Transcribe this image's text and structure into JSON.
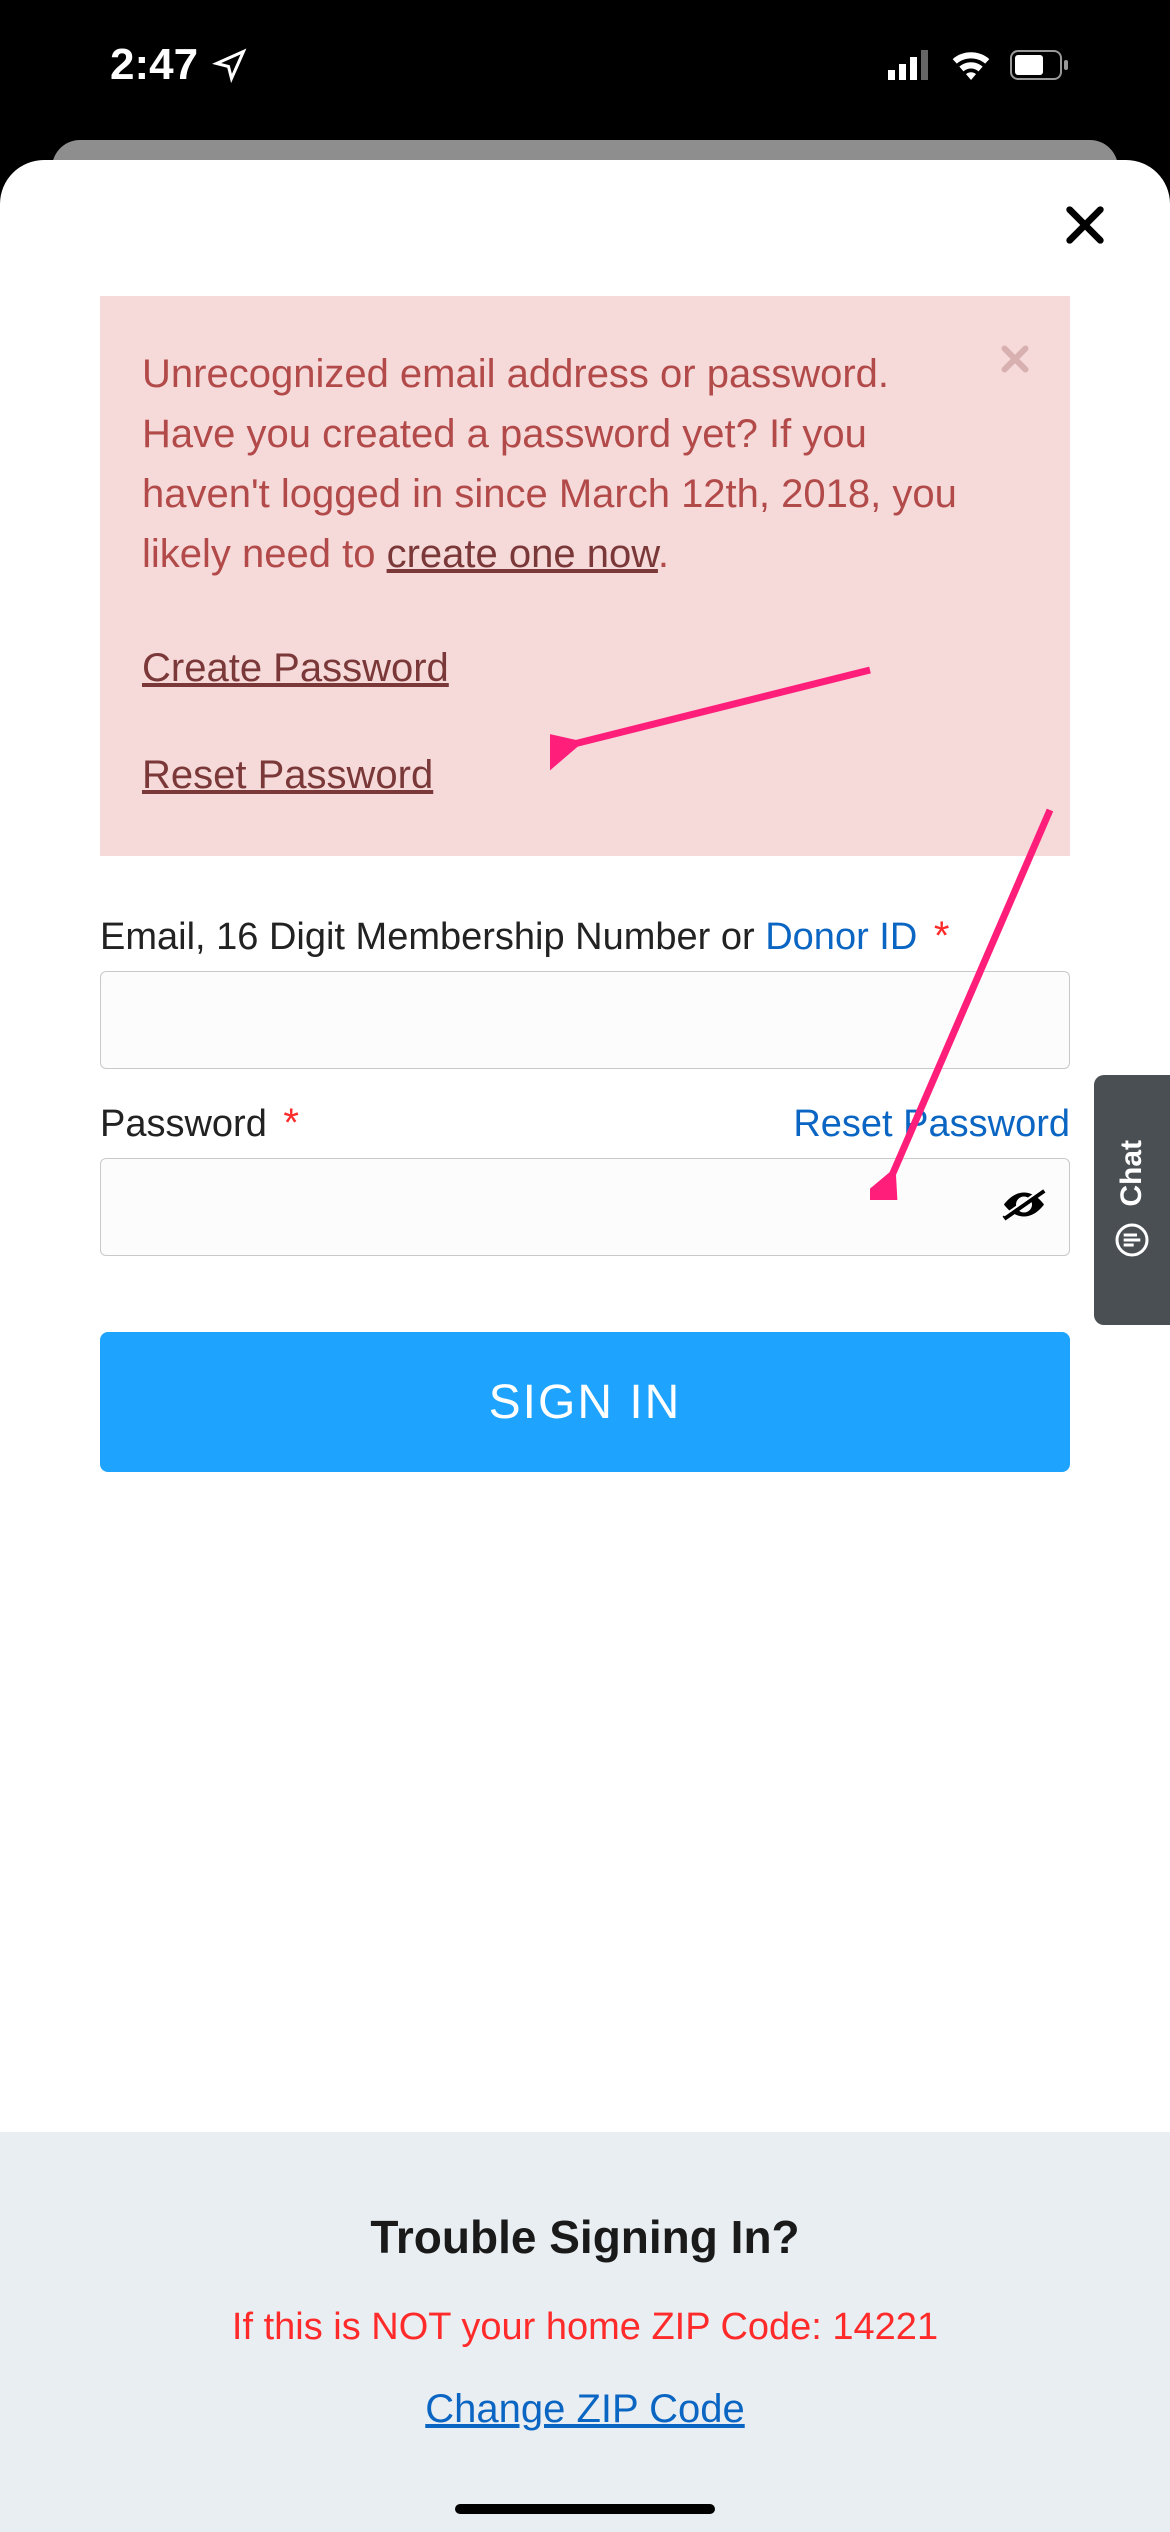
{
  "statusBar": {
    "time": "2:47"
  },
  "modal": {
    "alert": {
      "message_prefix": "Unrecognized email address or password. Have you created a password yet? If you haven't logged in since March 12th, 2018, you likely need to ",
      "message_link": "create one now",
      "message_suffix": ".",
      "create_password": "Create Password",
      "reset_password": "Reset Password"
    },
    "form": {
      "email_label_prefix": "Email, 16 Digit Membership Number or ",
      "email_label_link": "Donor ID",
      "password_label": "Password",
      "reset_password_link": "Reset Password",
      "required_mark": "*",
      "signin_button": "SIGN IN"
    }
  },
  "footer": {
    "heading": "Trouble Signing In?",
    "zip_line": "If this is NOT your home ZIP Code: 14221",
    "change_zip": "Change ZIP Code"
  },
  "chat": {
    "label": "Chat"
  }
}
